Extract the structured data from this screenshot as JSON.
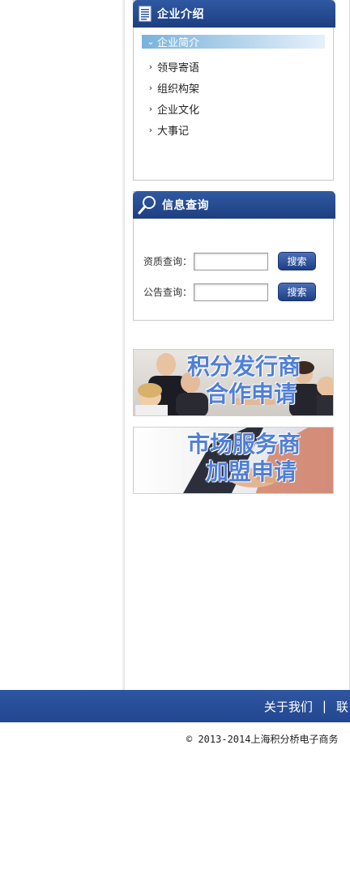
{
  "intro": {
    "title": "企业介绍",
    "items": [
      {
        "label": "企业简介",
        "active": true
      },
      {
        "label": "领导寄语",
        "active": false
      },
      {
        "label": "组织构架",
        "active": false
      },
      {
        "label": "企业文化",
        "active": false
      },
      {
        "label": "大事记",
        "active": false
      }
    ]
  },
  "search": {
    "title": "信息查询",
    "rows": [
      {
        "label": "资质查询：",
        "value": "",
        "button": "搜索"
      },
      {
        "label": "公告查询：",
        "value": "",
        "button": "搜索"
      }
    ]
  },
  "banners": [
    {
      "line1": "积分发行商",
      "line2": "合作申请"
    },
    {
      "line1": "市场服务商",
      "line2": "加盟申请"
    }
  ],
  "footer": {
    "links": [
      "关于我们",
      "联"
    ],
    "separator": "|",
    "copyright": "© 2013-2014上海积分桥电子商务"
  },
  "colors": {
    "header_blue": "#23478f",
    "banner_text": "#4f7fd8",
    "active_item": "#7ab2db"
  }
}
